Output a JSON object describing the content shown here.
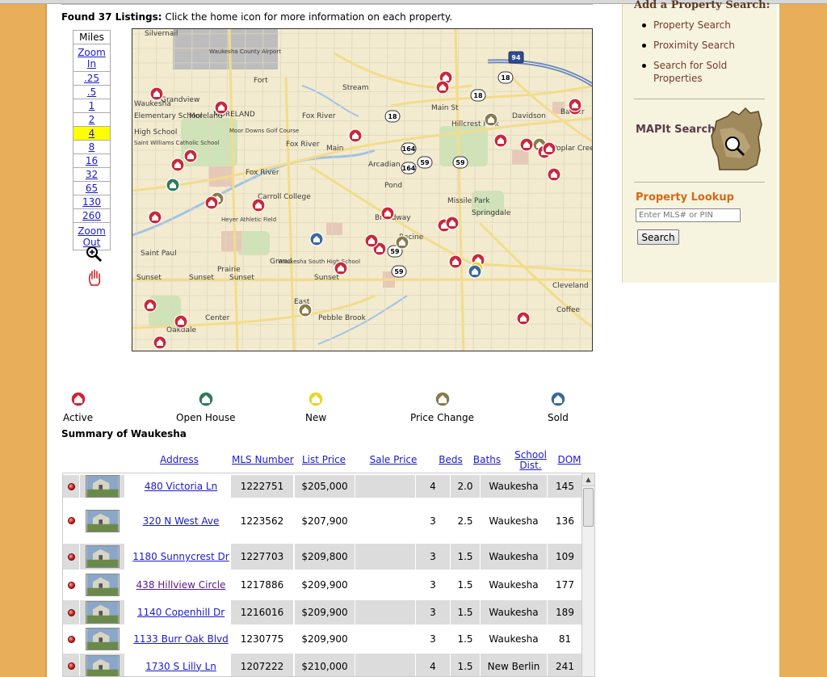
{
  "header": {
    "found_bold": "Found 37 Listings:",
    "found_rest": " Click the home icon for more information on each property."
  },
  "zoom": {
    "miles_label": "Miles",
    "zoom_in": "Zoom In",
    "zoom_out": "Zoom Out",
    "scales": [
      ".25",
      ".5",
      "1",
      "2",
      "4",
      "8",
      "16",
      "32",
      "65",
      "130",
      "260"
    ],
    "selected": "4"
  },
  "map": {
    "labels": [
      "Silvernail",
      "Waukesha County Airport",
      "Fort",
      "Waukesha",
      "MORELAND",
      "Fox River",
      "Moor Downs Golf Course",
      "Fox River",
      "Main",
      "Main St",
      "Hillcrest Park",
      "Davidson",
      "Arcadian",
      "Pond",
      "Broadway",
      "Racine",
      "Springdale",
      "Grand",
      "Prairie",
      "Sunset",
      "Sunset",
      "Sunset",
      "Sunset",
      "Pebble Brook",
      "Waukesha South High School",
      "Carroll College",
      "Cleveland",
      "Coffee",
      "Barker",
      "Poplar Creek",
      "Missile Park",
      "Stream",
      "Saint Paul",
      "Oakdale",
      "East",
      "Center",
      "Elementary School",
      "High School",
      "Saint Williams Catholic School",
      "Heyer Athletic Field",
      "Fox River",
      "Grandview",
      "Moreland"
    ],
    "route_shields": [
      "18",
      "18",
      "164",
      "164",
      "59",
      "59",
      "59",
      "59",
      "18",
      "94"
    ]
  },
  "legend": [
    {
      "label": "Active",
      "color": "#c8283a"
    },
    {
      "label": "Open House",
      "color": "#2e7a5a"
    },
    {
      "label": "New",
      "color": "#e6d62a"
    },
    {
      "label": "Price Change",
      "color": "#8a7a4a"
    },
    {
      "label": "Sold",
      "color": "#3a6a9a"
    }
  ],
  "summary_title": "Summary of Waukesha",
  "columns": {
    "address": "Address",
    "mls": "MLS Number",
    "list_price": "List Price",
    "sale_price": "Sale Price",
    "beds": "Beds",
    "baths": "Baths",
    "school_1": "School",
    "school_2": "Dist.",
    "dom": "DOM"
  },
  "listings": [
    {
      "address": "480 Victoria Ln",
      "mls": "1222751",
      "list_price": "$205,000",
      "sale_price": "",
      "beds": "4",
      "baths": "2.0",
      "school": "Waukesha",
      "dom": "145",
      "visited": false
    },
    {
      "address": "320 N West Ave",
      "mls": "1223562",
      "list_price": "$207,900",
      "sale_price": "",
      "beds": "3",
      "baths": "2.5",
      "school": "Waukesha",
      "dom": "136",
      "visited": false
    },
    {
      "address": "1180 Sunnycrest Dr",
      "mls": "1227703",
      "list_price": "$209,800",
      "sale_price": "",
      "beds": "3",
      "baths": "1.5",
      "school": "Waukesha",
      "dom": "109",
      "visited": false
    },
    {
      "address": "438 Hillview Circle",
      "mls": "1217886",
      "list_price": "$209,900",
      "sale_price": "",
      "beds": "3",
      "baths": "1.5",
      "school": "Waukesha",
      "dom": "177",
      "visited": true
    },
    {
      "address": "1140 Copenhill Dr",
      "mls": "1216016",
      "list_price": "$209,900",
      "sale_price": "",
      "beds": "3",
      "baths": "1.5",
      "school": "Waukesha",
      "dom": "189",
      "visited": false
    },
    {
      "address": "1133 Burr Oak Blvd",
      "mls": "1230775",
      "list_price": "$209,900",
      "sale_price": "",
      "beds": "3",
      "baths": "1.5",
      "school": "Waukesha",
      "dom": "81",
      "visited": false
    },
    {
      "address": "1730 S Lilly Ln",
      "mls": "1207222",
      "list_price": "$210,000",
      "sale_price": "",
      "beds": "4",
      "baths": "1.5",
      "school": "New Berlin",
      "dom": "241",
      "visited": false
    }
  ],
  "sidebar": {
    "heading": "Add a Property Search:",
    "links": [
      "Property Search",
      "Proximity Search",
      "Search for Sold Properties"
    ],
    "mapit": "MAPIt Search",
    "lookup_title": "Property Lookup",
    "lookup_placeholder": "Enter MLS# or PIN",
    "search_button": "Search"
  },
  "colors": {
    "page_bg": "#e9ae5a",
    "sidebar_bg": "#f6f3df",
    "link": "#1a1acc",
    "accent_orange": "#d26a16",
    "zoom_selected": "#ffff00"
  }
}
